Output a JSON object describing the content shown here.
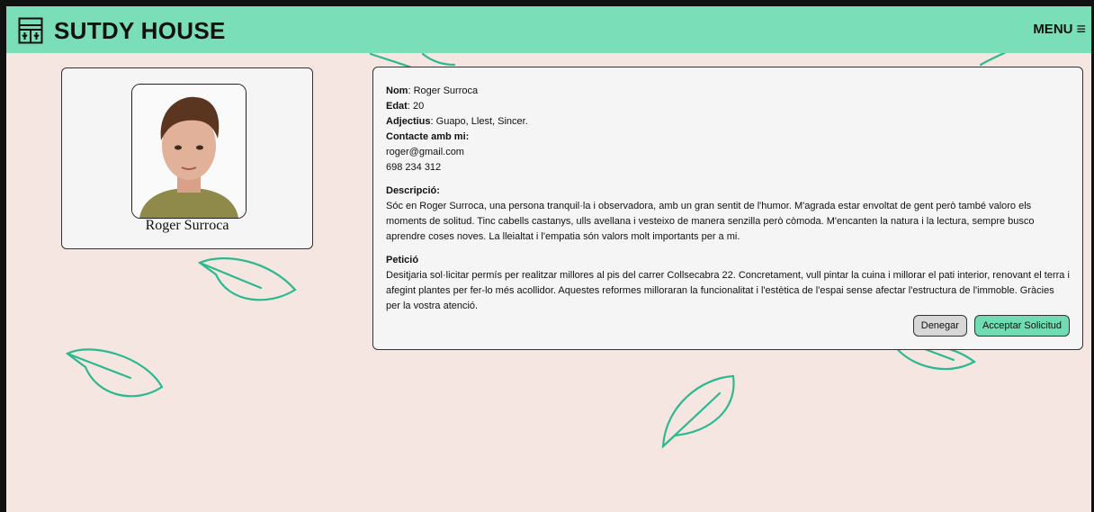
{
  "header": {
    "brand": "SUTDY HOUSE",
    "menu_label": "MENU",
    "menu_icon": "≡"
  },
  "profile": {
    "name": "Roger Surroca"
  },
  "info": {
    "name_label": "Nom",
    "name_value": "Roger Surroca",
    "age_label": "Edat",
    "age_value": "20",
    "adjectives_label": "Adjectius",
    "adjectives_value": "Guapo, Llest, Sincer.",
    "contact_label": "Contacte amb mi:",
    "email": "roger@gmail.com",
    "phone": "698 234 312",
    "description_title": "Descripció:",
    "description_text": "Sóc en Roger Surroca, una persona tranquil·la i observadora, amb un gran sentit de l'humor. M'agrada estar envoltat de gent però també valoro els moments de solitud. Tinc cabells castanys, ulls avellana i vesteixo de manera senzilla però còmoda. M'encanten la natura i la lectura, sempre busco aprendre coses noves. La lleialtat i l'empatia són valors molt importants per a mi.",
    "request_title": "Petició",
    "request_text": "Desitjaria sol·licitar permís per realitzar millores al pis del carrer Collsecabra 22. Concretament, vull pintar la cuina i millorar el pati interior, renovant el terra i afegint plantes per fer-lo més acollidor. Aquestes reformes milloraran la funcionalitat i l'estètica de l'espai sense afectar l'estructura de l'immoble. Gràcies per la vostra atenció."
  },
  "actions": {
    "deny_label": "Denegar",
    "accept_label": "Acceptar Solicitud"
  },
  "colors": {
    "header": "#7adfb8",
    "background": "#f6e6e1",
    "leaf": "#2cb98f",
    "accept": "#6fdcb3"
  }
}
